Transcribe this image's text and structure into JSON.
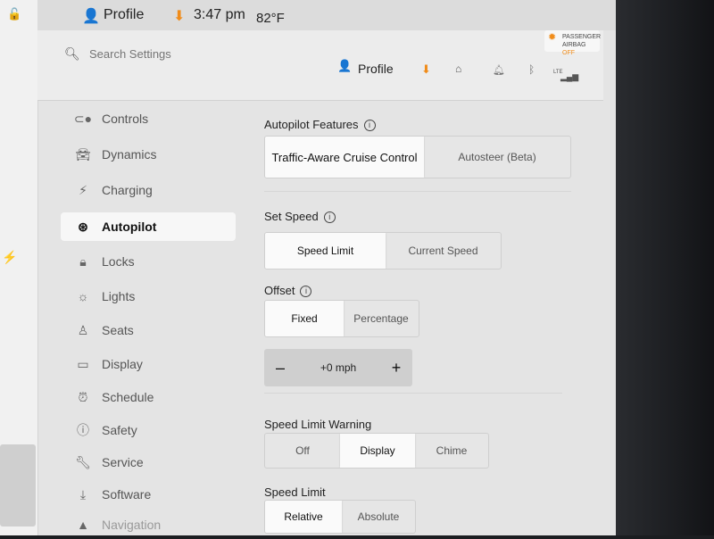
{
  "status_bar": {
    "profile_label": "Profile",
    "time": "3:47 pm",
    "temperature": "82°F"
  },
  "header": {
    "search_placeholder": "Search Settings",
    "profile_label": "Profile",
    "airbag_line1": "PASSENGER",
    "airbag_line2": "AIRBAG",
    "airbag_state": "OFF",
    "network": "LTE"
  },
  "sidebar": {
    "items": [
      {
        "label": "Controls",
        "icon": "toggle-icon"
      },
      {
        "label": "Dynamics",
        "icon": "car-icon"
      },
      {
        "label": "Charging",
        "icon": "bolt-icon"
      },
      {
        "label": "Autopilot",
        "icon": "steering-wheel-icon"
      },
      {
        "label": "Locks",
        "icon": "lock-icon"
      },
      {
        "label": "Lights",
        "icon": "sun-icon"
      },
      {
        "label": "Seats",
        "icon": "seat-icon"
      },
      {
        "label": "Display",
        "icon": "display-icon"
      },
      {
        "label": "Schedule",
        "icon": "alarm-icon"
      },
      {
        "label": "Safety",
        "icon": "info-circle-icon"
      },
      {
        "label": "Service",
        "icon": "wrench-icon"
      },
      {
        "label": "Software",
        "icon": "download-icon"
      },
      {
        "label": "Navigation",
        "icon": "navigation-icon"
      }
    ]
  },
  "autopilot": {
    "features_label": "Autopilot Features",
    "features_options": [
      "Traffic-Aware Cruise Control",
      "Autosteer (Beta)"
    ],
    "set_speed_label": "Set Speed",
    "set_speed_options": [
      "Speed Limit",
      "Current Speed"
    ],
    "offset_label": "Offset",
    "offset_options": [
      "Fixed",
      "Percentage"
    ],
    "offset_value": "+0 mph",
    "stepper_minus": "–",
    "stepper_plus": "+",
    "warning_label": "Speed Limit Warning",
    "warning_options": [
      "Off",
      "Display",
      "Chime"
    ],
    "limit_label": "Speed Limit",
    "limit_options": [
      "Relative",
      "Absolute"
    ]
  },
  "colors": {
    "accent": "#f08c1a",
    "background": "#e4e4e4",
    "selected": "#fafafa"
  }
}
